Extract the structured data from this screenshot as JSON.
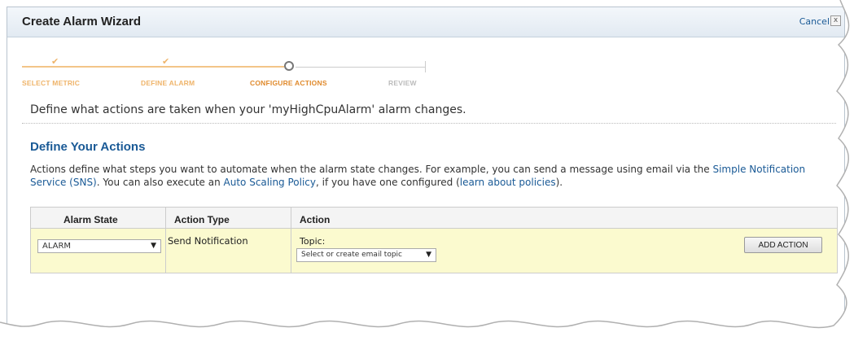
{
  "wizard": {
    "title": "Create Alarm Wizard",
    "cancel_label": "Cancel",
    "close_glyph": "x",
    "steps": [
      {
        "label": "SELECT METRIC",
        "status": "done"
      },
      {
        "label": "DEFINE ALARM",
        "status": "done"
      },
      {
        "label": "CONFIGURE ACTIONS",
        "status": "current"
      },
      {
        "label": "REVIEW",
        "status": "pending"
      }
    ],
    "check_glyph": "✔"
  },
  "intro": "Define what actions are taken when your 'myHighCpuAlarm' alarm changes.",
  "section": {
    "title": "Define Your Actions",
    "desc_part1": "Actions define what steps you want to automate when the alarm state changes. For example, you can send a message using email via the",
    "link_sns": "Simple Notification Service (SNS)",
    "desc_part2": ". You can also execute an",
    "link_autoscaling": "Auto Scaling Policy",
    "desc_part3": ", if you have one configured (",
    "link_policies": "learn about policies",
    "desc_part4": ")."
  },
  "table": {
    "headers": [
      "Alarm State",
      "Action Type",
      "Action"
    ],
    "row": {
      "alarm_state": "ALARM",
      "action_type": "Send Notification",
      "topic_label": "Topic:",
      "topic_value": "Select or create email topic",
      "add_button": "ADD ACTION"
    }
  },
  "colors": {
    "accent": "#1a5a96",
    "step_done": "#efb46a",
    "step_current": "#e08a2c",
    "row_highlight": "#fbfacf"
  }
}
